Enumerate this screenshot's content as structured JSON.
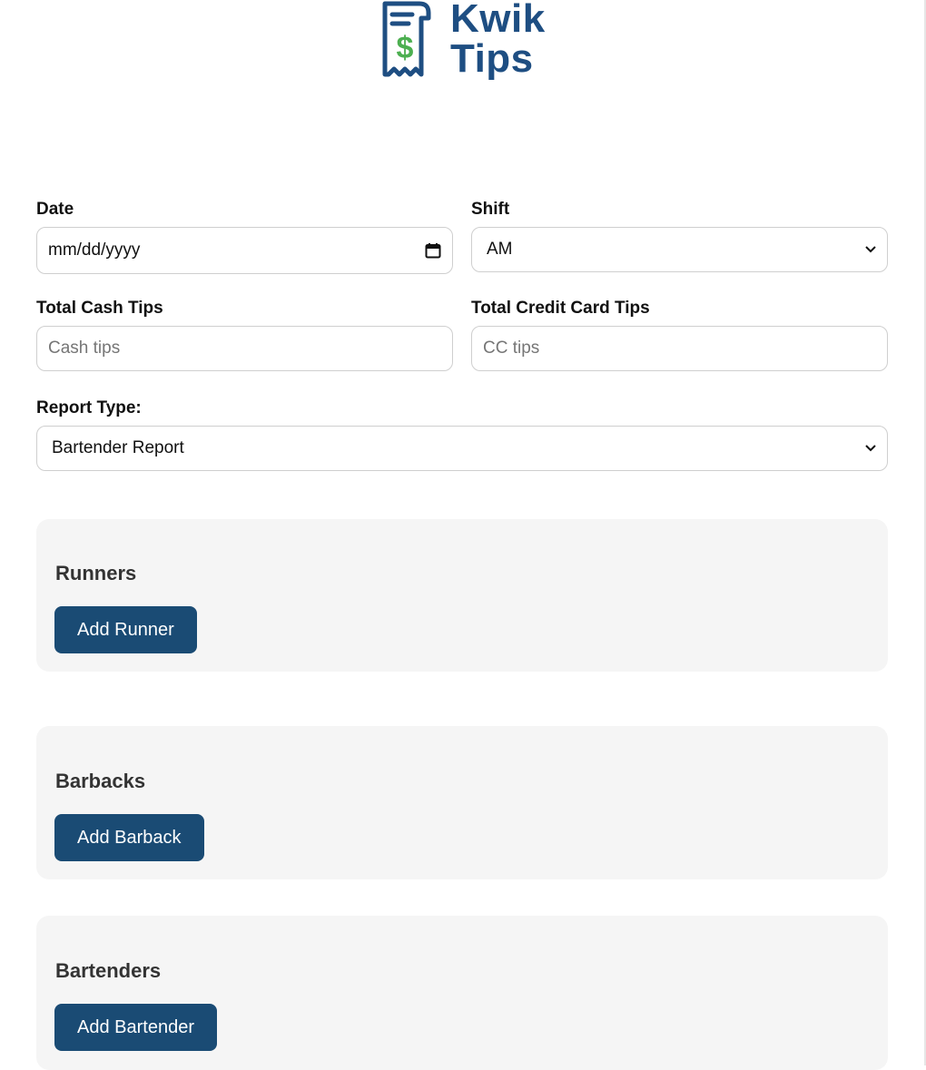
{
  "brand": {
    "line1": "Kwik",
    "line2": "Tips",
    "color": "#1e4e82",
    "dollar_color": "#4caf50"
  },
  "form": {
    "date": {
      "label": "Date",
      "value": "mm/dd/yyyy",
      "icon": "calendar-icon"
    },
    "shift": {
      "label": "Shift",
      "selected": "AM",
      "icon": "chevron-down-icon"
    },
    "cash": {
      "label": "Total Cash Tips",
      "placeholder": "Cash tips"
    },
    "cc": {
      "label": "Total Credit Card Tips",
      "placeholder": "CC tips"
    },
    "report": {
      "label": "Report Type:",
      "selected": "Bartender Report",
      "icon": "chevron-down-icon"
    }
  },
  "sections": {
    "runners": {
      "title": "Runners",
      "button": "Add Runner"
    },
    "barbacks": {
      "title": "Barbacks",
      "button": "Add Barback"
    },
    "bartenders": {
      "title": "Bartenders",
      "button": "Add Bartender"
    }
  },
  "colors": {
    "button_bg": "#1a4b74",
    "card_bg": "#f5f5f5"
  }
}
